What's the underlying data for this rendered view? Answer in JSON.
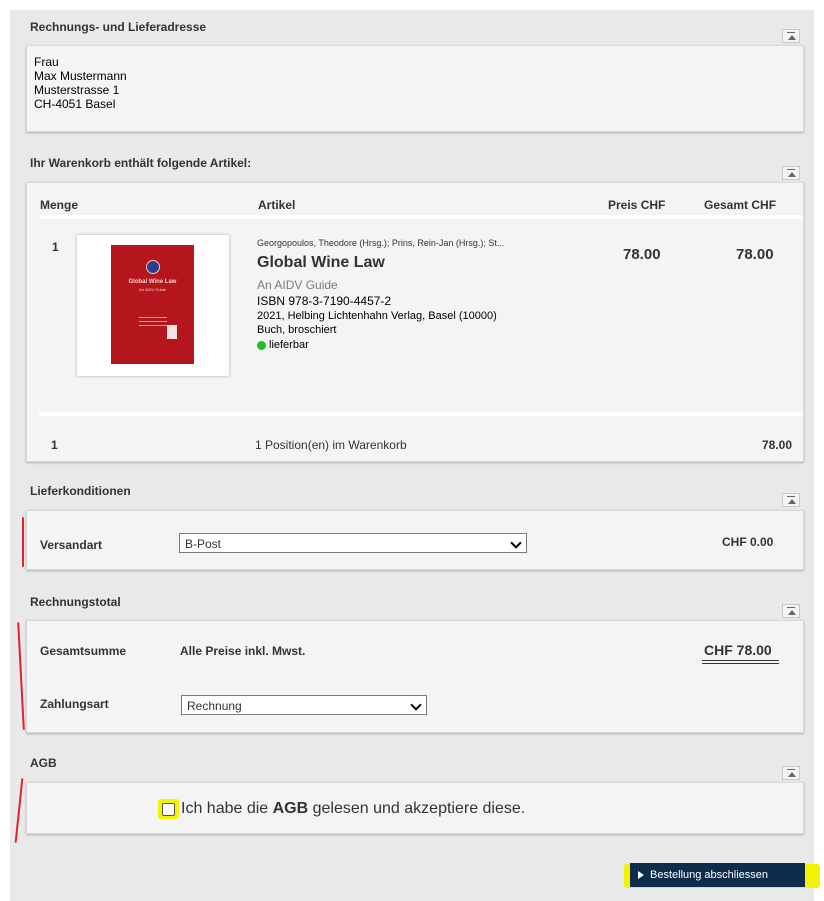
{
  "address": {
    "title": "Rechnungs- und Lieferadresse",
    "lines": [
      "Frau",
      "Max Mustermann",
      "Musterstrasse 1",
      "CH-4051 Basel"
    ]
  },
  "cart": {
    "title": "Ihr Warenkorb enthält folgende Artikel:",
    "columns": {
      "quantity": "Menge",
      "article": "Artikel",
      "price": "Preis CHF",
      "total": "Gesamt CHF"
    },
    "item": {
      "quantity": "1",
      "authors": "Georgopoulos, Theodore (Hrsg.); Prins, Rein-Jan (Hrsg.); St...",
      "title": "Global Wine Law",
      "subtitle": "An AIDV Guide",
      "isbn": "ISBN 978-3-7190-4457-2",
      "publisher": "2021, Helbing Lichtenhahn Verlag, Basel (10000)",
      "binding": "Buch, broschiert",
      "availability": "lieferbar",
      "price": "78.00",
      "total": "78.00",
      "cover_title": "Global Wine Law",
      "cover_subtitle": "An AIDV Guide"
    },
    "summary": {
      "quantity": "1",
      "positions": "1 Position(en) im Warenkorb",
      "total": "78.00"
    }
  },
  "delivery": {
    "title": "Lieferkonditionen",
    "shipping_label": "Versandart",
    "shipping_value": "B-Post",
    "shipping_cost": "CHF 0.00"
  },
  "invoice": {
    "title": "Rechnungstotal",
    "sum_label": "Gesamtsumme",
    "vat_note": "Alle Preise inkl. Mwst.",
    "sum_value": "CHF 78.00",
    "payment_label": "Zahlungsart",
    "payment_value": "Rechnung"
  },
  "agb": {
    "title": "AGB",
    "text_before": "Ich habe die ",
    "text_bold": "AGB",
    "text_after": " gelesen und akzeptiere diese."
  },
  "order_button": {
    "label": "Bestellung abschliessen"
  },
  "colors": {
    "page_bg": "#e9e9e9",
    "panel_bg": "#f4f4f4",
    "button_bg": "#0e2d4d",
    "highlight": "#f3f300",
    "annotation_red": "#e0232b",
    "available_green": "#19c21e"
  }
}
